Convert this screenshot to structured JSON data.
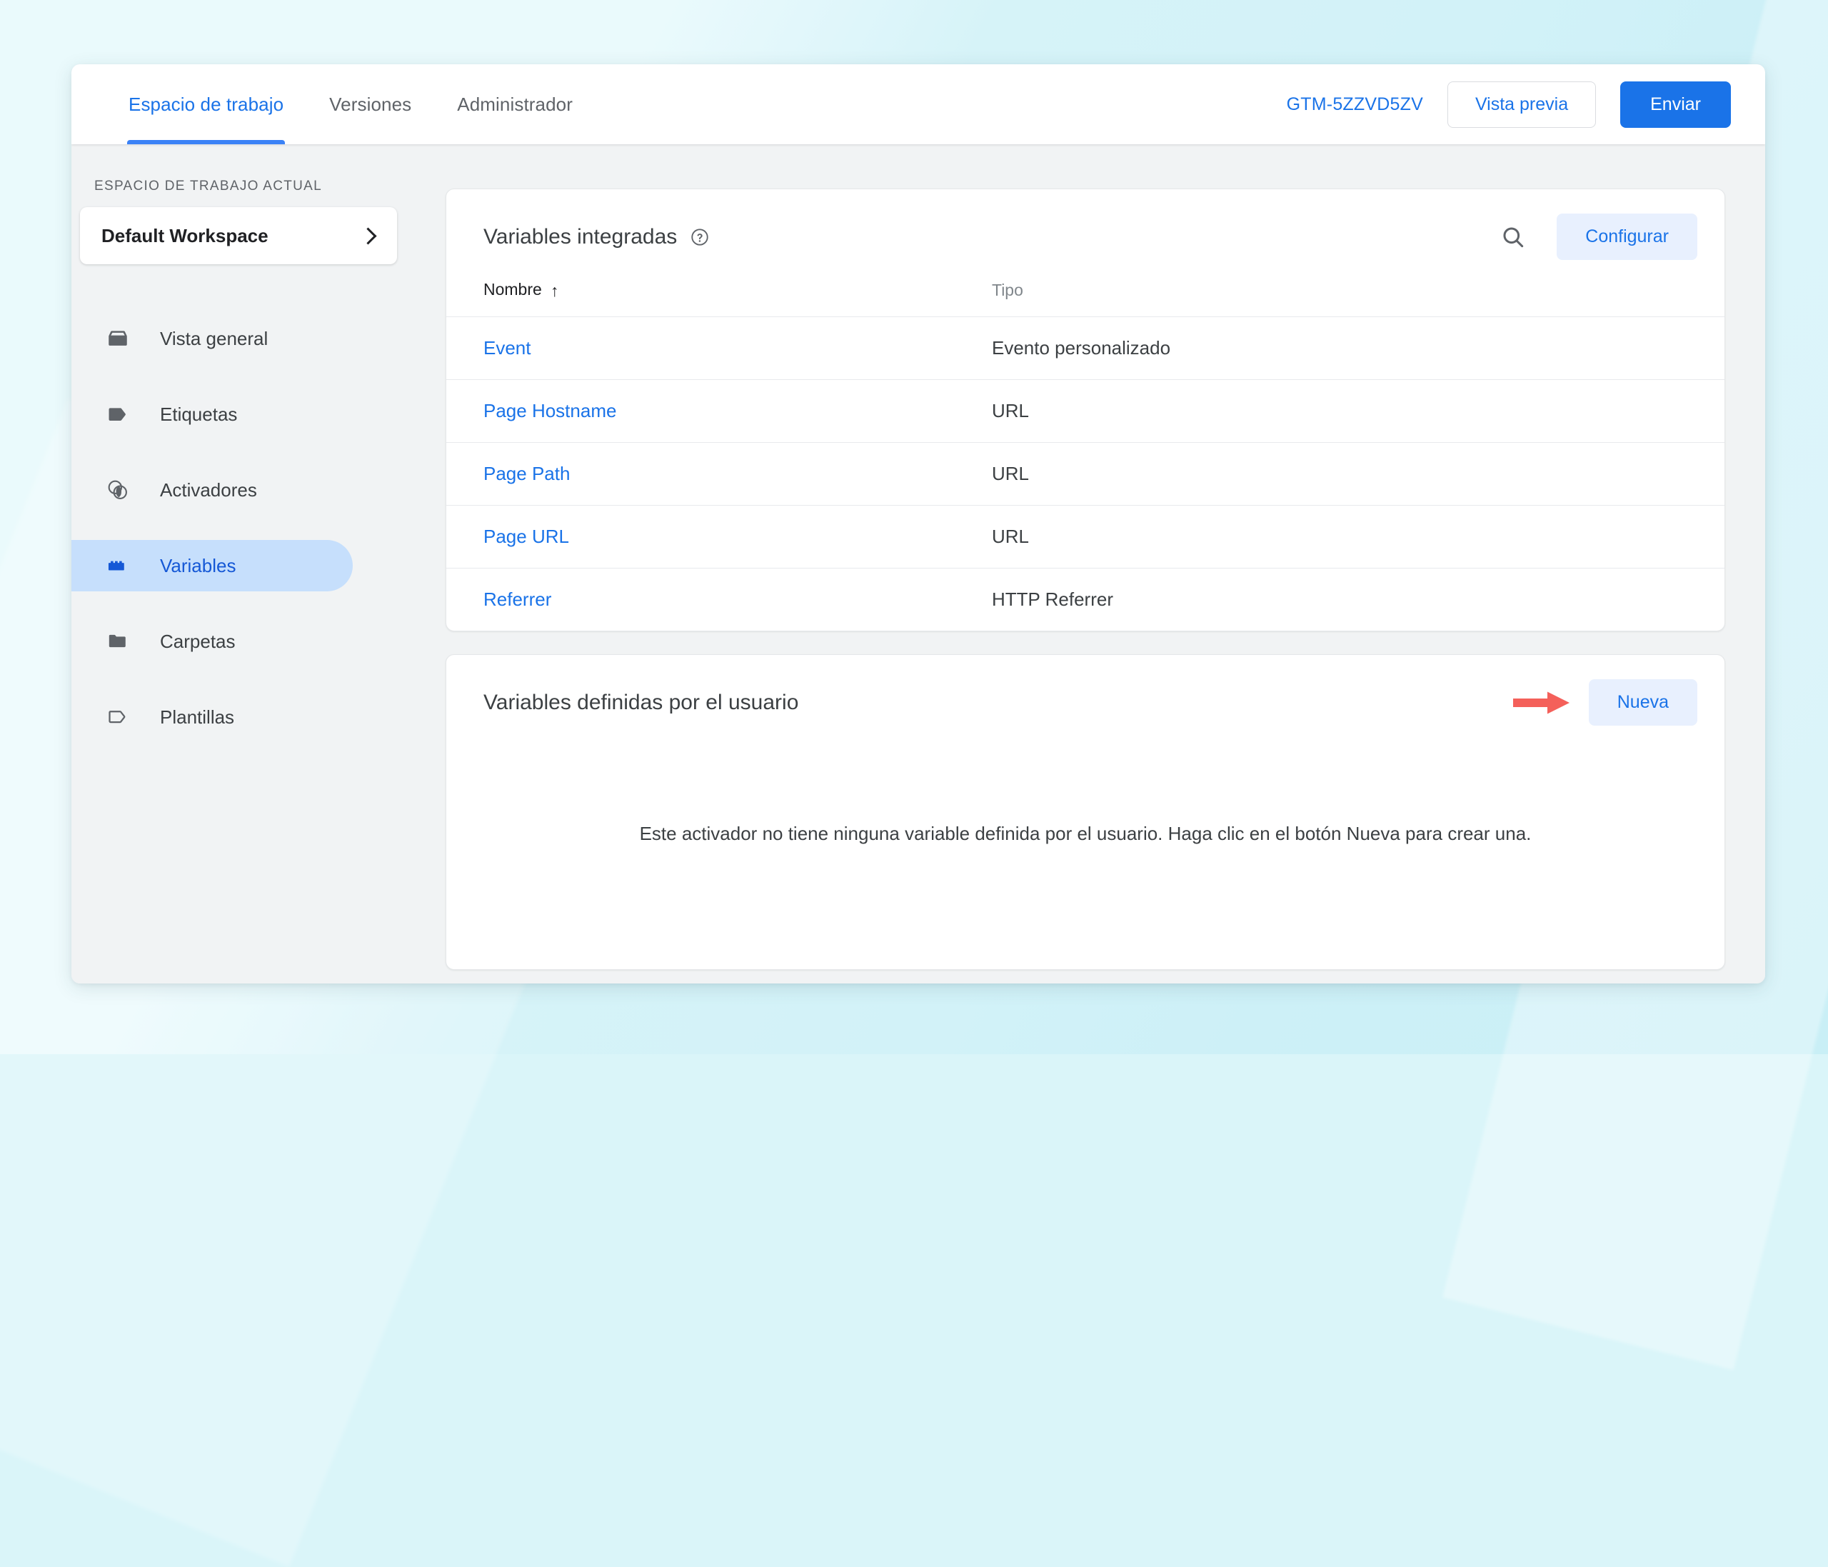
{
  "colors": {
    "accent_blue": "#1a73e8",
    "tab_underline": "#3b82f6",
    "active_nav_bg": "#c6dffc",
    "active_nav_text": "#1558d6",
    "tonal_button_bg": "#e8f0fe",
    "annotation_red": "#f4605a",
    "page_background": "#daf5f9",
    "panel_background": "#f1f3f4"
  },
  "topbar": {
    "tabs": [
      {
        "label": "Espacio de trabajo",
        "active": true
      },
      {
        "label": "Versiones",
        "active": false
      },
      {
        "label": "Administrador",
        "active": false
      }
    ],
    "container_id": "GTM-5ZZVD5ZV",
    "preview_label": "Vista previa",
    "submit_label": "Enviar"
  },
  "sidebar": {
    "section_label": "ESPACIO DE TRABAJO ACTUAL",
    "workspace_name": "Default Workspace",
    "workspace_chevron_icon": "chevron-right-icon",
    "items": [
      {
        "label": "Vista general",
        "icon": "overview-box-icon",
        "active": false
      },
      {
        "label": "Etiquetas",
        "icon": "tag-icon",
        "active": false
      },
      {
        "label": "Activadores",
        "icon": "trigger-circles-icon",
        "active": false
      },
      {
        "label": "Variables",
        "icon": "brick-icon",
        "active": true
      },
      {
        "label": "Carpetas",
        "icon": "folder-icon",
        "active": false
      },
      {
        "label": "Plantillas",
        "icon": "template-tag-outline-icon",
        "active": false
      }
    ]
  },
  "builtin_card": {
    "title": "Variables integradas",
    "help_icon": "help-circle-icon",
    "search_icon": "search-icon",
    "configure_label": "Configurar",
    "columns": {
      "name": "Nombre",
      "type": "Tipo",
      "sort_indicator": "↑"
    },
    "rows": [
      {
        "name": "Event",
        "type": "Evento personalizado"
      },
      {
        "name": "Page Hostname",
        "type": "URL"
      },
      {
        "name": "Page Path",
        "type": "URL"
      },
      {
        "name": "Page URL",
        "type": "URL"
      },
      {
        "name": "Referrer",
        "type": "HTTP Referrer"
      }
    ]
  },
  "user_card": {
    "title": "Variables definidas por el usuario",
    "annotation_icon": "red-right-arrow-icon",
    "new_label": "Nueva",
    "empty_message": "Este activador no tiene ninguna variable definida por el usuario. Haga clic en el botón Nueva para crear una."
  }
}
